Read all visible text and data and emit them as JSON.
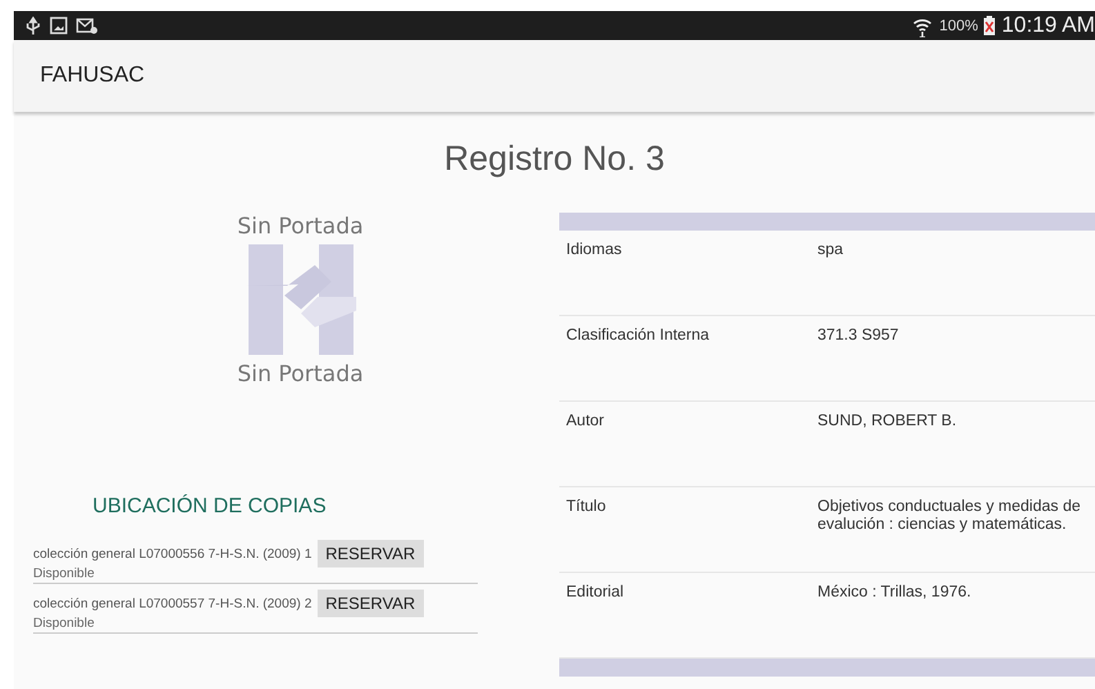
{
  "status_bar": {
    "battery": "100%",
    "time": "10:19 AM"
  },
  "app_bar": {
    "title": "FAHUSAC"
  },
  "page_title": "Registro No. 3",
  "cover": {
    "caption_top": "Sin Portada",
    "caption_bottom": "Sin Portada"
  },
  "copies": {
    "heading": "UBICACIÓN DE COPIAS",
    "items": [
      {
        "location": "colección general L07000556 7-H-S.N. (2009) 1",
        "status": "Disponible",
        "button": "RESERVAR"
      },
      {
        "location": "colección general L07000557 7-H-S.N. (2009) 2",
        "status": "Disponible",
        "button": "RESERVAR"
      }
    ]
  },
  "details": [
    {
      "label": "Idiomas",
      "value": "spa"
    },
    {
      "label": "Clasificación Interna",
      "value": "371.3 S957"
    },
    {
      "label": "Autor",
      "value": "SUND, ROBERT B."
    },
    {
      "label": "Título",
      "value": "Objetivos conductuales y medidas de evalución :  ciencias y matemáticas."
    },
    {
      "label": "Editorial",
      "value": "México :  Trillas,  1976."
    }
  ]
}
